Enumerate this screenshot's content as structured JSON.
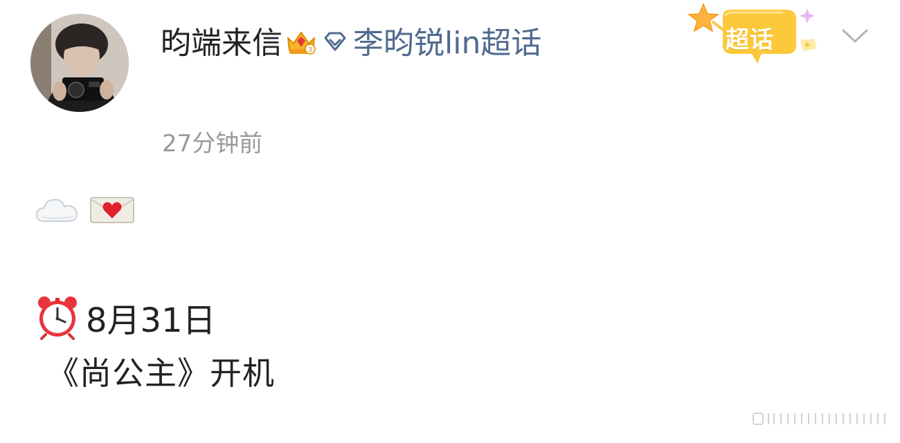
{
  "post": {
    "username": "昀端来信",
    "topic": "李昀锐lin超话",
    "timestamp": "27分钟前",
    "badge_text": "超话",
    "date_line": "8月31日",
    "content_line": "《尚公主》开机"
  },
  "icons": {
    "avatar": "avatar-photo",
    "crown": "crown-icon",
    "diamond": "diamond-icon",
    "badge": "supertopic-badge-icon",
    "chevron": "chevron-down-icon",
    "cloud": "cloud-emoji-icon",
    "love_letter": "love-letter-emoji-icon",
    "alarm": "alarm-clock-emoji-icon"
  },
  "colors": {
    "text": "#222222",
    "link": "#506a8f",
    "muted": "#9a9a9a",
    "badge": "#fcc93d"
  }
}
